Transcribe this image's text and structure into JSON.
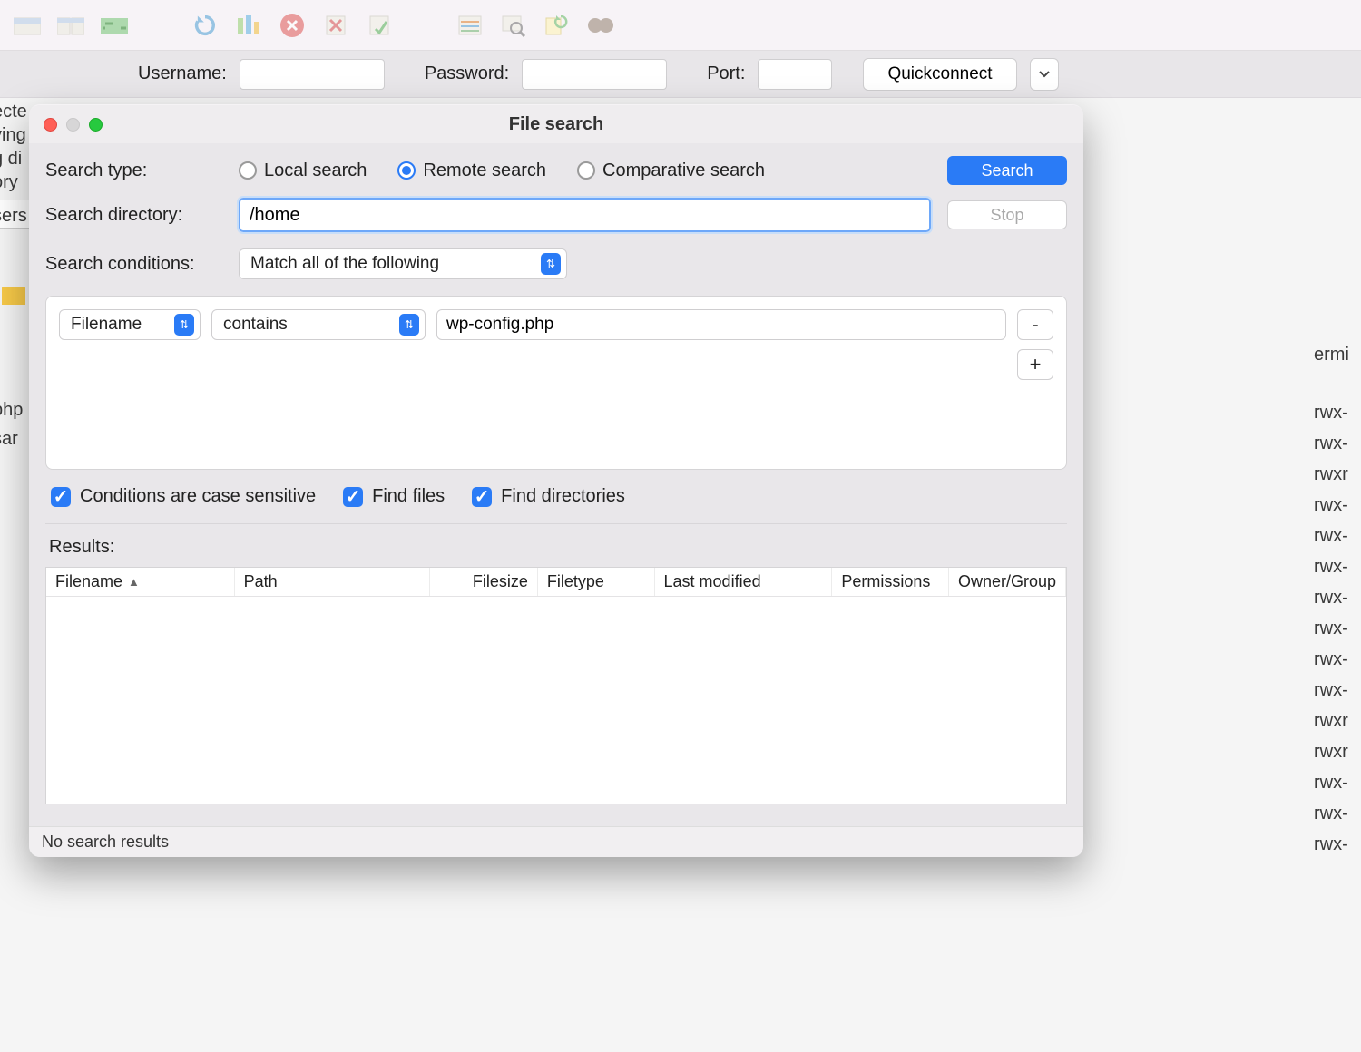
{
  "quickconnect": {
    "username_label": "Username:",
    "password_label": "Password:",
    "port_label": "Port:",
    "button": "Quickconnect"
  },
  "bg_left": "ecte\nving\ng di\nory",
  "bg_left2": "sers",
  "bg_left3": "php\nsar",
  "bg_right_top": "ermi",
  "bg_right_perms": "rwx-\nrwx-\nrwxr\nrwx-\nrwx-\nrwx-\nrwx-\nrwx-\nrwx-\nrwx-\nrwxr\nrwxr\nrwx-\nrwx-\nrwx-",
  "dialog": {
    "title": "File search",
    "labels": {
      "search_type": "Search type:",
      "search_directory": "Search directory:",
      "search_conditions": "Search conditions:",
      "results": "Results:"
    },
    "radios": {
      "local": "Local search",
      "remote": "Remote search",
      "comparative": "Comparative search",
      "selected": "remote"
    },
    "buttons": {
      "search": "Search",
      "stop": "Stop",
      "minus": "-",
      "plus": "+"
    },
    "directory_value": "/home",
    "match_select": "Match all of the following",
    "condition": {
      "field": "Filename",
      "op": "contains",
      "value": "wp-config.php"
    },
    "checks": {
      "case": "Conditions are case sensitive",
      "files": "Find files",
      "dirs": "Find directories"
    },
    "columns": {
      "filename": "Filename",
      "path": "Path",
      "filesize": "Filesize",
      "filetype": "Filetype",
      "modified": "Last modified",
      "permissions": "Permissions",
      "owner": "Owner/Group"
    },
    "status": "No search results"
  }
}
